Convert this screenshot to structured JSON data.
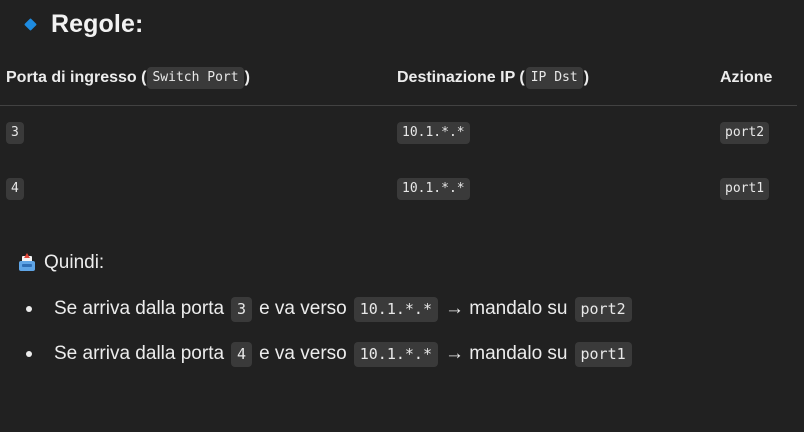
{
  "heading": {
    "title": "Regole:",
    "icon": "diamond-icon"
  },
  "table": {
    "headers": [
      {
        "text_before": "Porta di ingresso (",
        "code": "Switch Port",
        "text_after": ")"
      },
      {
        "text_before": "Destinazione IP (",
        "code": "IP Dst",
        "text_after": ")"
      },
      {
        "text": "Azione"
      }
    ],
    "rows": [
      {
        "port": "3",
        "ip": "10.1.*.*",
        "action": "port2"
      },
      {
        "port": "4",
        "ip": "10.1.*.*",
        "action": "port1"
      }
    ]
  },
  "summary": {
    "icon": "outbox-tray-icon",
    "label": "Quindi:",
    "items": [
      {
        "t1": "Se arriva dalla porta",
        "port": "3",
        "t2": "e va verso",
        "ip": "10.1.*.*",
        "t3": "→ mandalo su",
        "action": "port2"
      },
      {
        "t1": "Se arriva dalla porta",
        "port": "4",
        "t2": "e va verso",
        "ip": "10.1.*.*",
        "t3": "→ mandalo su",
        "action": "port1"
      }
    ]
  },
  "colors": {
    "background": "#212121",
    "text": "#ececec",
    "code_bg": "#3a3a3a",
    "accent": "#1e8be0"
  }
}
